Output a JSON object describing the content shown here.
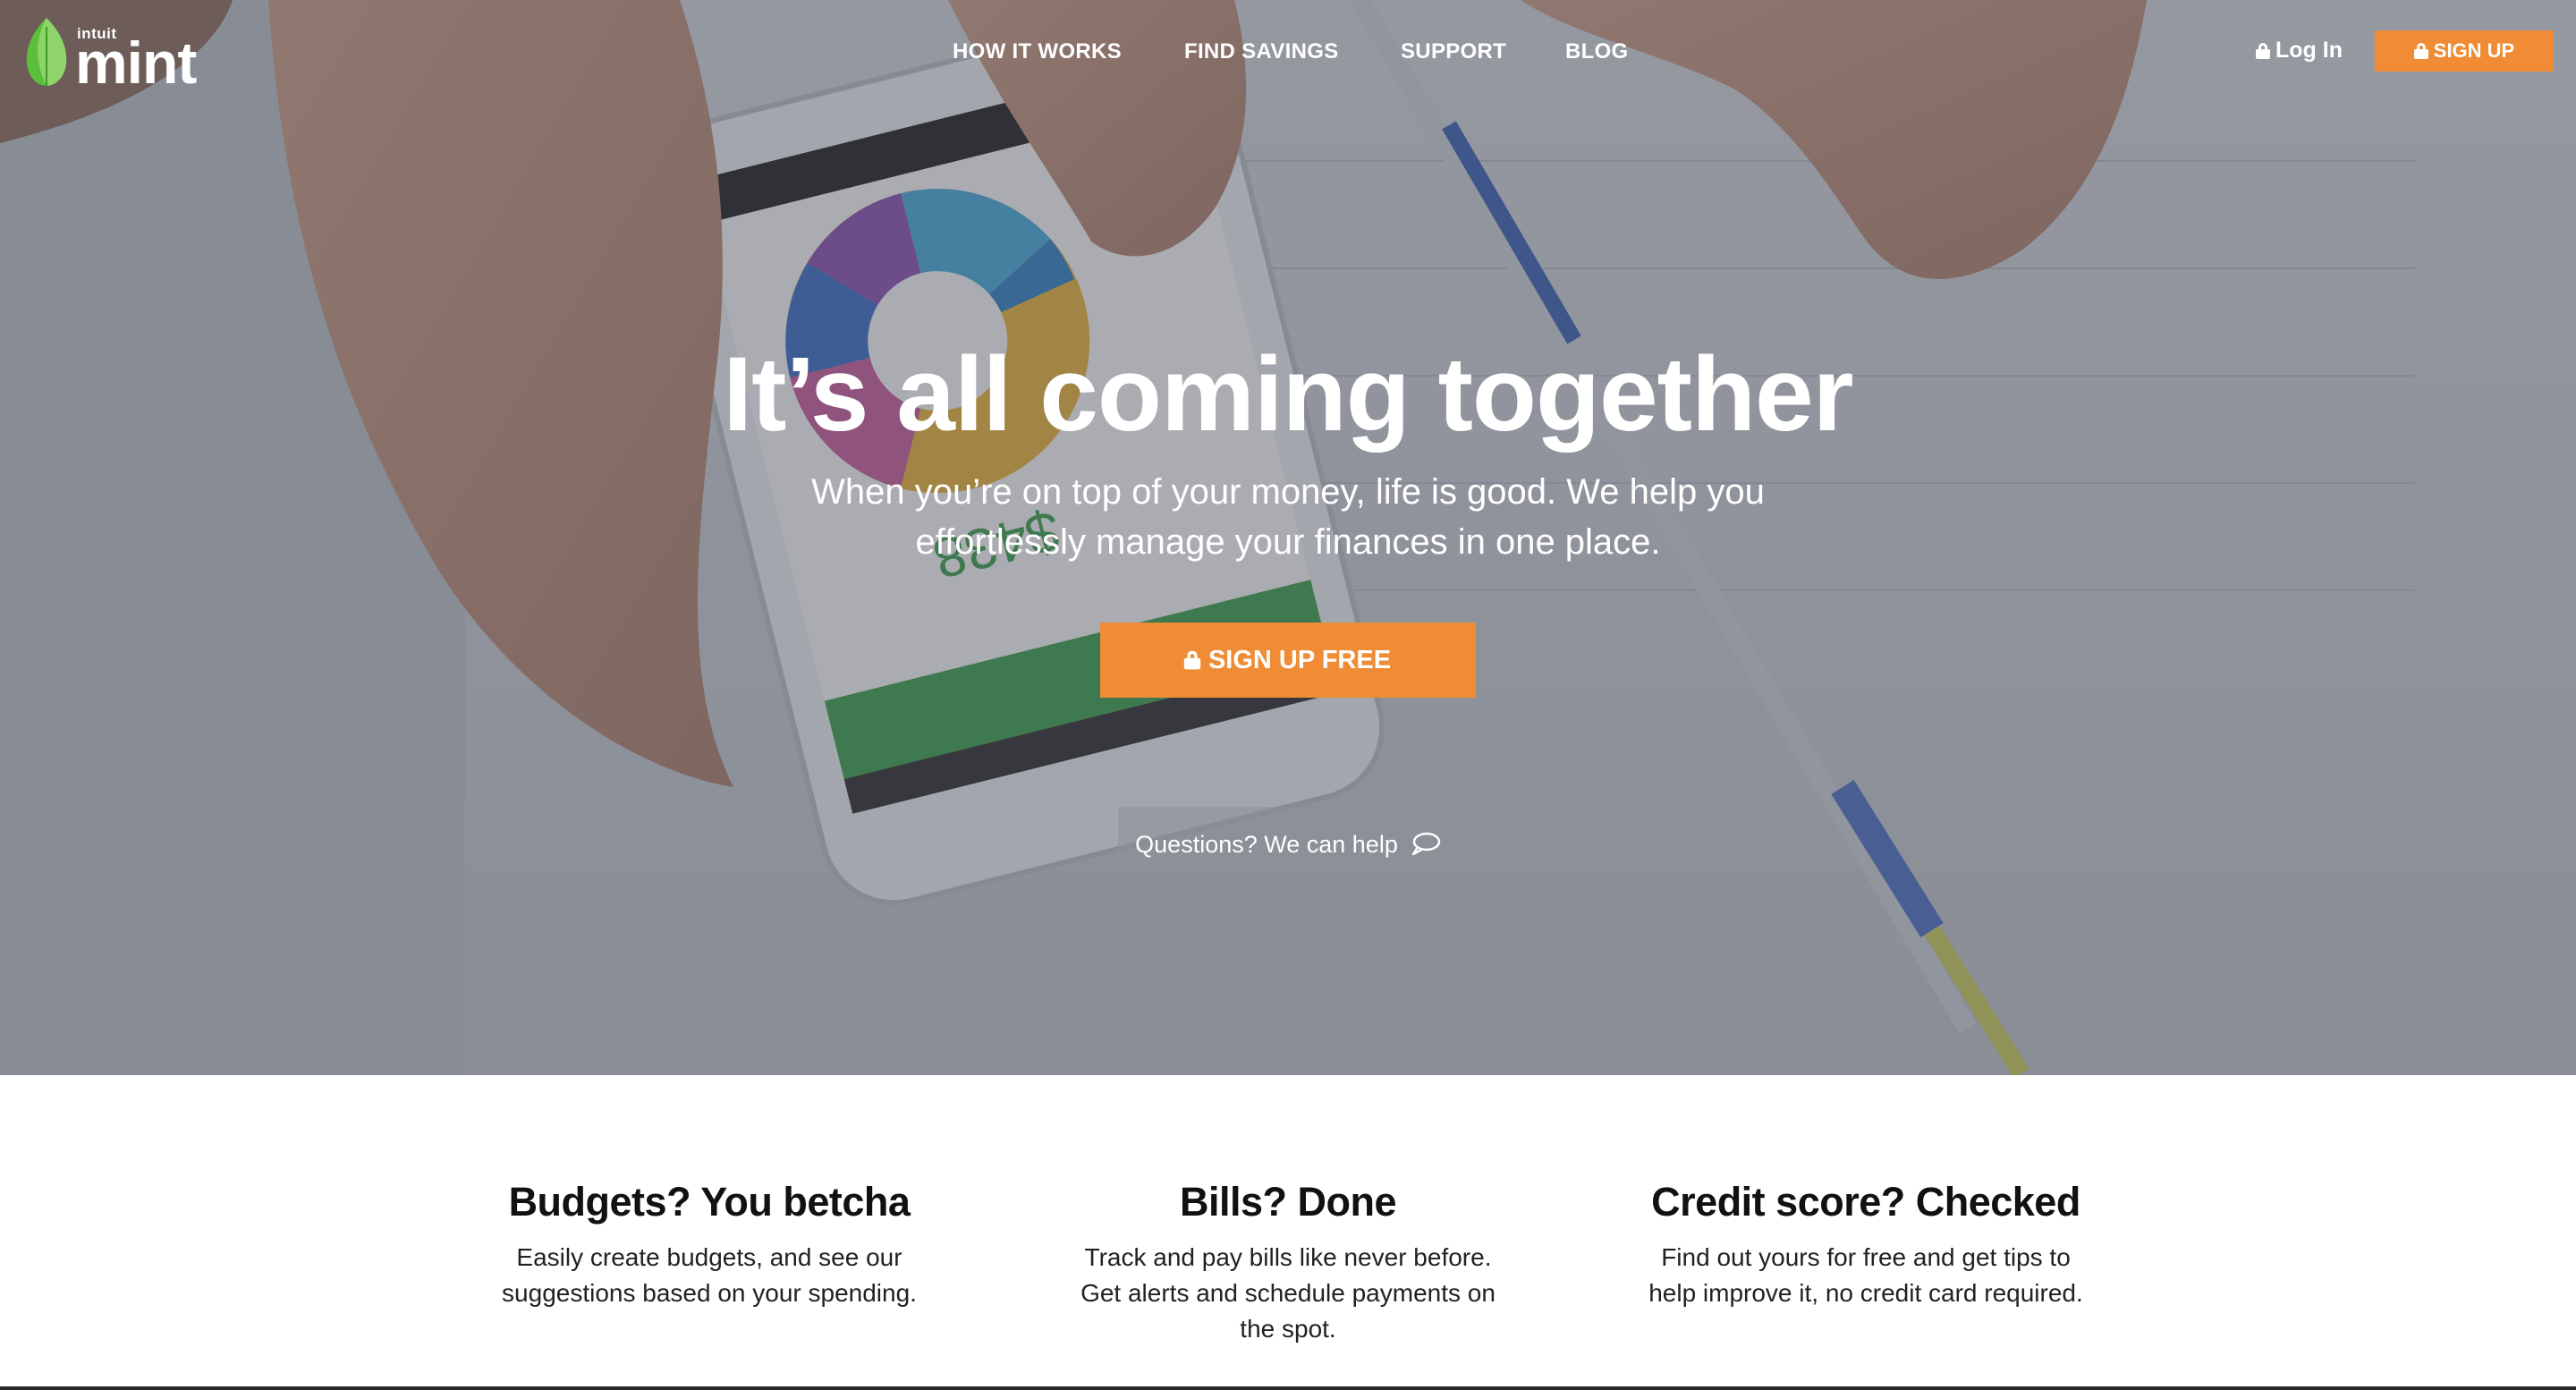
{
  "brand": {
    "company": "intuit",
    "product": "mint"
  },
  "nav": {
    "links": [
      "HOW IT WORKS",
      "FIND SAVINGS",
      "SUPPORT",
      "BLOG"
    ],
    "login_label": "Log In",
    "signup_label": "SIGN UP"
  },
  "hero": {
    "headline": "It’s all coming together",
    "subhead_line1": "When you’re on top of your money, life is good. We help you",
    "subhead_line2": "effortlessly manage your finances in one place.",
    "cta_label": "SIGN UP FREE",
    "help_label": "Questions? We can help"
  },
  "features": [
    {
      "title": "Budgets? You betcha",
      "lines": [
        "Easily create budgets, and see our",
        "suggestions based on your spending."
      ]
    },
    {
      "title": "Bills? Done",
      "lines": [
        "Track and pay bills like never before.",
        "Get alerts and schedule payments on",
        "the spot."
      ]
    },
    {
      "title": "Credit score? Checked",
      "lines": [
        "Find out yours for free and get tips to",
        "help improve it, no credit card required."
      ]
    }
  ],
  "colors": {
    "accent": "#ef8c35",
    "logo_green": "#5cbf3b",
    "hero_overlay": "#5c606b"
  },
  "icons": {
    "logo": "mint-leaf-icon",
    "lock": "lock-icon",
    "help": "speech-bubble-icon"
  }
}
